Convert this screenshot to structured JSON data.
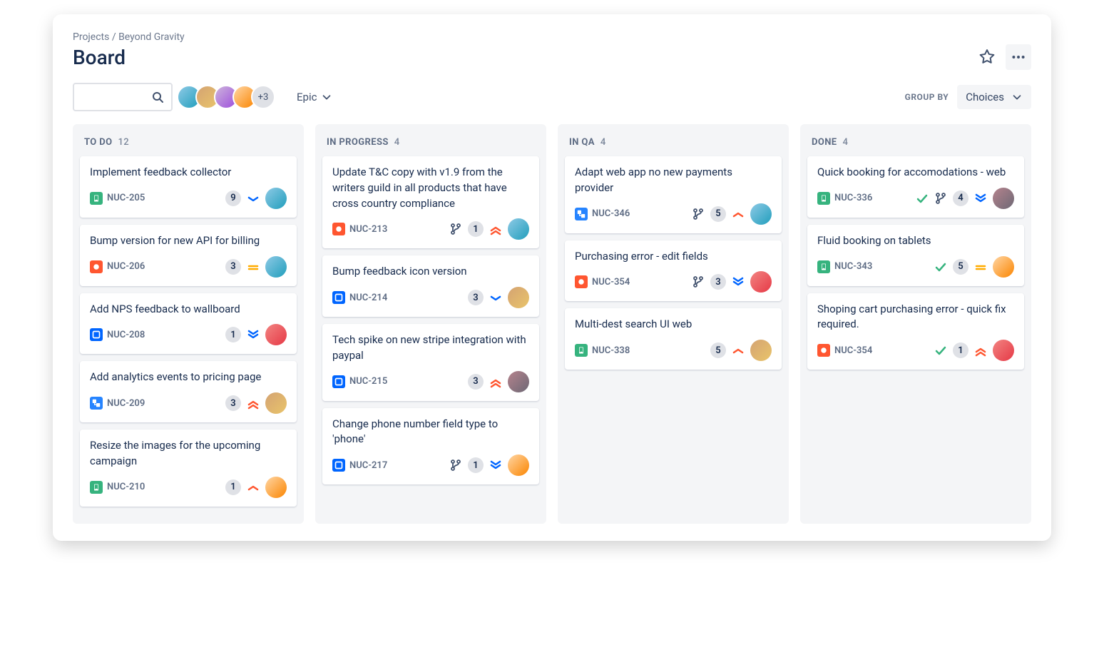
{
  "breadcrumb": {
    "projects": "Projects",
    "sep": " / ",
    "name": "Beyond Gravity"
  },
  "title": "Board",
  "toolbar": {
    "avatars_more": "+3",
    "epic_label": "Epic",
    "groupby_label": "GROUP BY",
    "choices_label": "Choices"
  },
  "columns": [
    {
      "title": "TO DO",
      "count": "12",
      "cards": [
        {
          "title": "Implement feedback collector",
          "type": "story",
          "id": "NUC-205",
          "badge": "9",
          "priority": "low",
          "avatar": "a1"
        },
        {
          "title": "Bump version for new API for billing",
          "type": "bug",
          "id": "NUC-206",
          "badge": "3",
          "priority": "medium",
          "avatar": "a1"
        },
        {
          "title": "Add NPS feedback to wallboard",
          "type": "task",
          "id": "NUC-208",
          "badge": "1",
          "priority": "lowest",
          "avatar": "a5"
        },
        {
          "title": "Add analytics events to pricing page",
          "type": "subtask",
          "id": "NUC-209",
          "badge": "3",
          "priority": "highest",
          "avatar": "a2"
        },
        {
          "title": "Resize the images for the upcoming campaign",
          "type": "story",
          "id": "NUC-210",
          "badge": "1",
          "priority": "high",
          "avatar": "a4"
        }
      ]
    },
    {
      "title": "IN PROGRESS",
      "count": "4",
      "cards": [
        {
          "title": "Update T&C copy with v1.9 from the writers guild in all products that have cross country compliance",
          "type": "bug",
          "id": "NUC-213",
          "branch": true,
          "badge": "1",
          "priority": "highest",
          "avatar": "a1"
        },
        {
          "title": "Bump feedback icon version",
          "type": "task",
          "id": "NUC-214",
          "badge": "3",
          "priority": "low",
          "avatar": "a2"
        },
        {
          "title": "Tech spike on new stripe integration with paypal",
          "type": "task",
          "id": "NUC-215",
          "badge": "3",
          "priority": "highest",
          "avatar": "a6"
        },
        {
          "title": "Change phone number field type to 'phone'",
          "type": "task",
          "id": "NUC-217",
          "branch": true,
          "badge": "1",
          "priority": "lowest",
          "avatar": "a4"
        }
      ]
    },
    {
      "title": "IN QA",
      "count": "4",
      "cards": [
        {
          "title": "Adapt web app no new payments provider",
          "type": "subtask",
          "id": "NUC-346",
          "branch": true,
          "badge": "5",
          "priority": "high",
          "avatar": "a1"
        },
        {
          "title": "Purchasing error - edit fields",
          "type": "bug",
          "id": "NUC-354",
          "branch": true,
          "badge": "3",
          "priority": "lowest",
          "avatar": "a5"
        },
        {
          "title": "Multi-dest search UI web",
          "type": "story",
          "id": "NUC-338",
          "badge": "5",
          "priority": "high",
          "avatar": "a2"
        }
      ]
    },
    {
      "title": "DONE",
      "count": "4",
      "cards": [
        {
          "title": "Quick booking for accomodations - web",
          "type": "story",
          "id": "NUC-336",
          "done": true,
          "branch": true,
          "badge": "4",
          "priority": "lowest",
          "avatar": "a6"
        },
        {
          "title": "Fluid booking on tablets",
          "type": "story",
          "id": "NUC-343",
          "done": true,
          "badge": "5",
          "priority": "medium",
          "avatar": "a4"
        },
        {
          "title": "Shoping cart purchasing error - quick fix required.",
          "type": "bug",
          "id": "NUC-354",
          "done": true,
          "badge": "1",
          "priority": "highest",
          "avatar": "a5"
        }
      ]
    }
  ]
}
